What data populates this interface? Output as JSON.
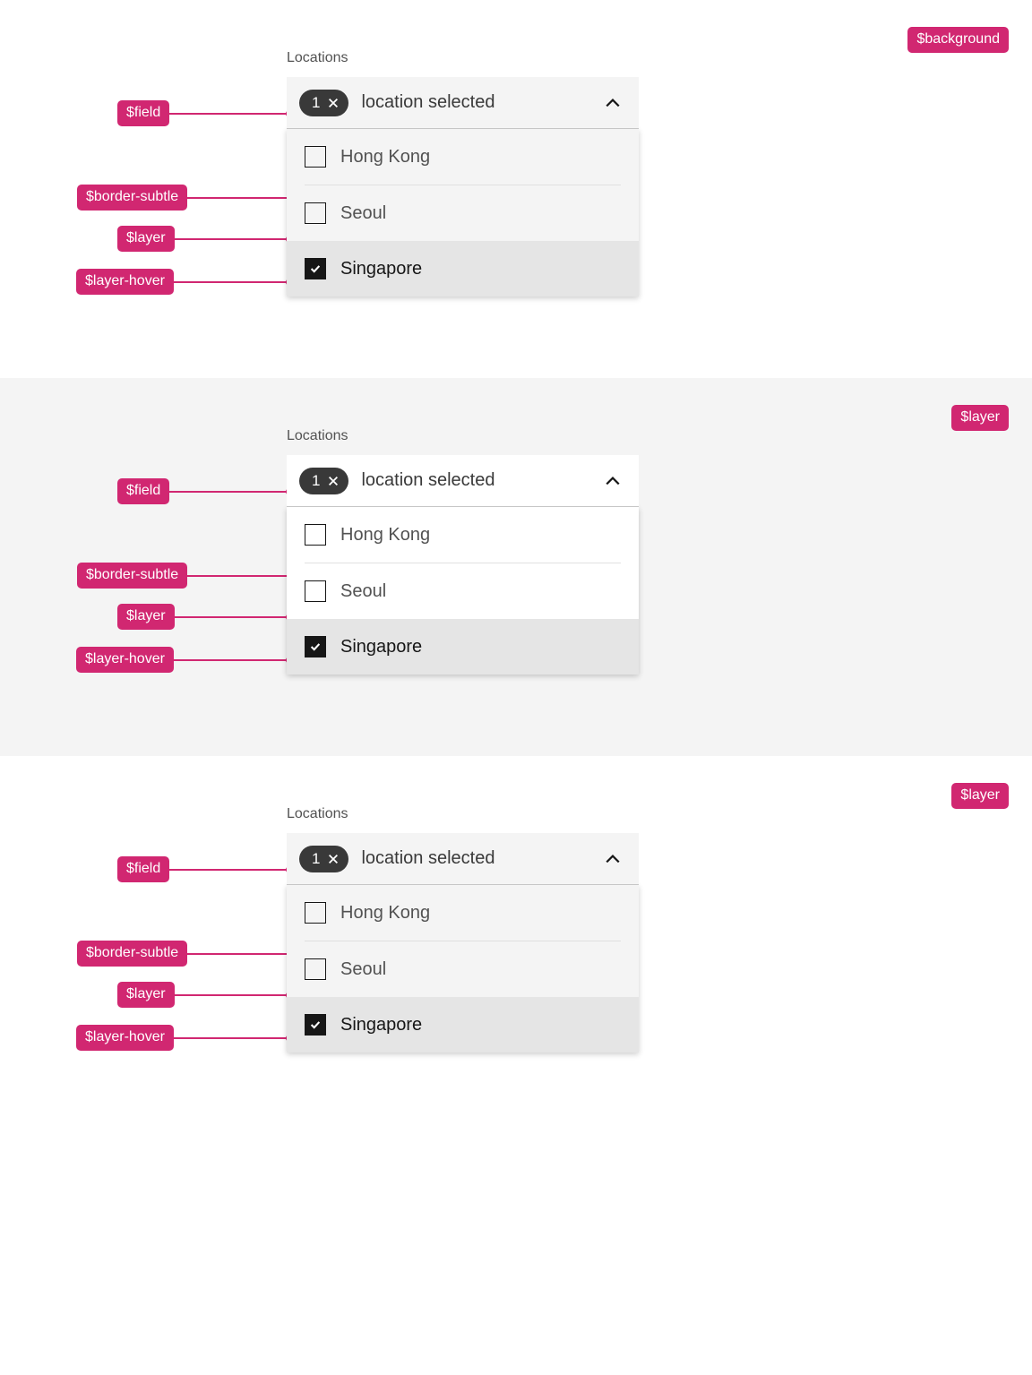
{
  "tokens": {
    "background": "$background",
    "field": "$field",
    "border_subtle": "$border-subtle",
    "layer": "$layer",
    "layer_hover": "$layer-hover"
  },
  "multiselect": {
    "label": "Locations",
    "count": "1",
    "summary": "location selected",
    "options": {
      "a": "Hong Kong",
      "b": "Seoul",
      "c": "Singapore"
    }
  },
  "colors": {
    "pink": "#d12771",
    "gray10": "#f4f4f4",
    "gray20": "#e0e0e0",
    "gray70": "#525252",
    "gray80": "#393939"
  }
}
